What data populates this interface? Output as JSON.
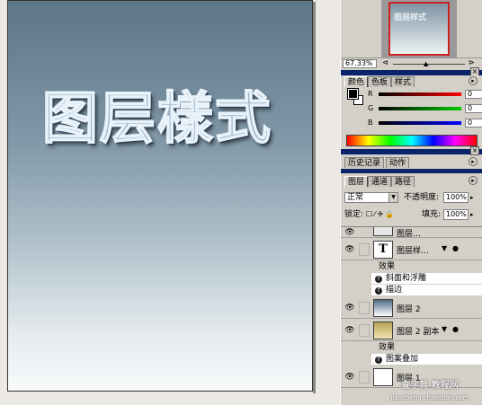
{
  "canvas": {
    "art_text": "图层樣式"
  },
  "navigator": {
    "thumb_text": "图层样式",
    "zoom": "67.33%"
  },
  "color_panel": {
    "tabs": [
      "颜色",
      "色板",
      "样式"
    ],
    "channels": [
      {
        "label": "R",
        "value": "0"
      },
      {
        "label": "G",
        "value": "0"
      },
      {
        "label": "B",
        "value": "0"
      }
    ]
  },
  "history_panel": {
    "tabs": [
      "历史记录",
      "动作"
    ]
  },
  "layers_panel": {
    "tabs": [
      "图层",
      "通道",
      "路径"
    ],
    "blend_mode": "正常",
    "opacity_label": "不透明度:",
    "opacity": "100%",
    "lock_label": "锁定:",
    "fill_label": "填充:",
    "fill": "100%",
    "layers": [
      {
        "name": "图层…",
        "type": "partial"
      },
      {
        "name": "图层样…",
        "type": "text"
      },
      {
        "name": "图层 2",
        "type": "gradient"
      },
      {
        "name": "图层 2 副本",
        "type": "pattern"
      },
      {
        "name": "图层 1",
        "type": "white"
      }
    ],
    "text_effects_label": "效果",
    "text_effects": [
      "斜面和浮雕",
      "描边"
    ],
    "copy_effects_label": "效果",
    "copy_effects": [
      "图案叠加"
    ]
  },
  "watermark": {
    "text": "查字典 教程网",
    "url": "jiaocheng.chazidian.com"
  }
}
